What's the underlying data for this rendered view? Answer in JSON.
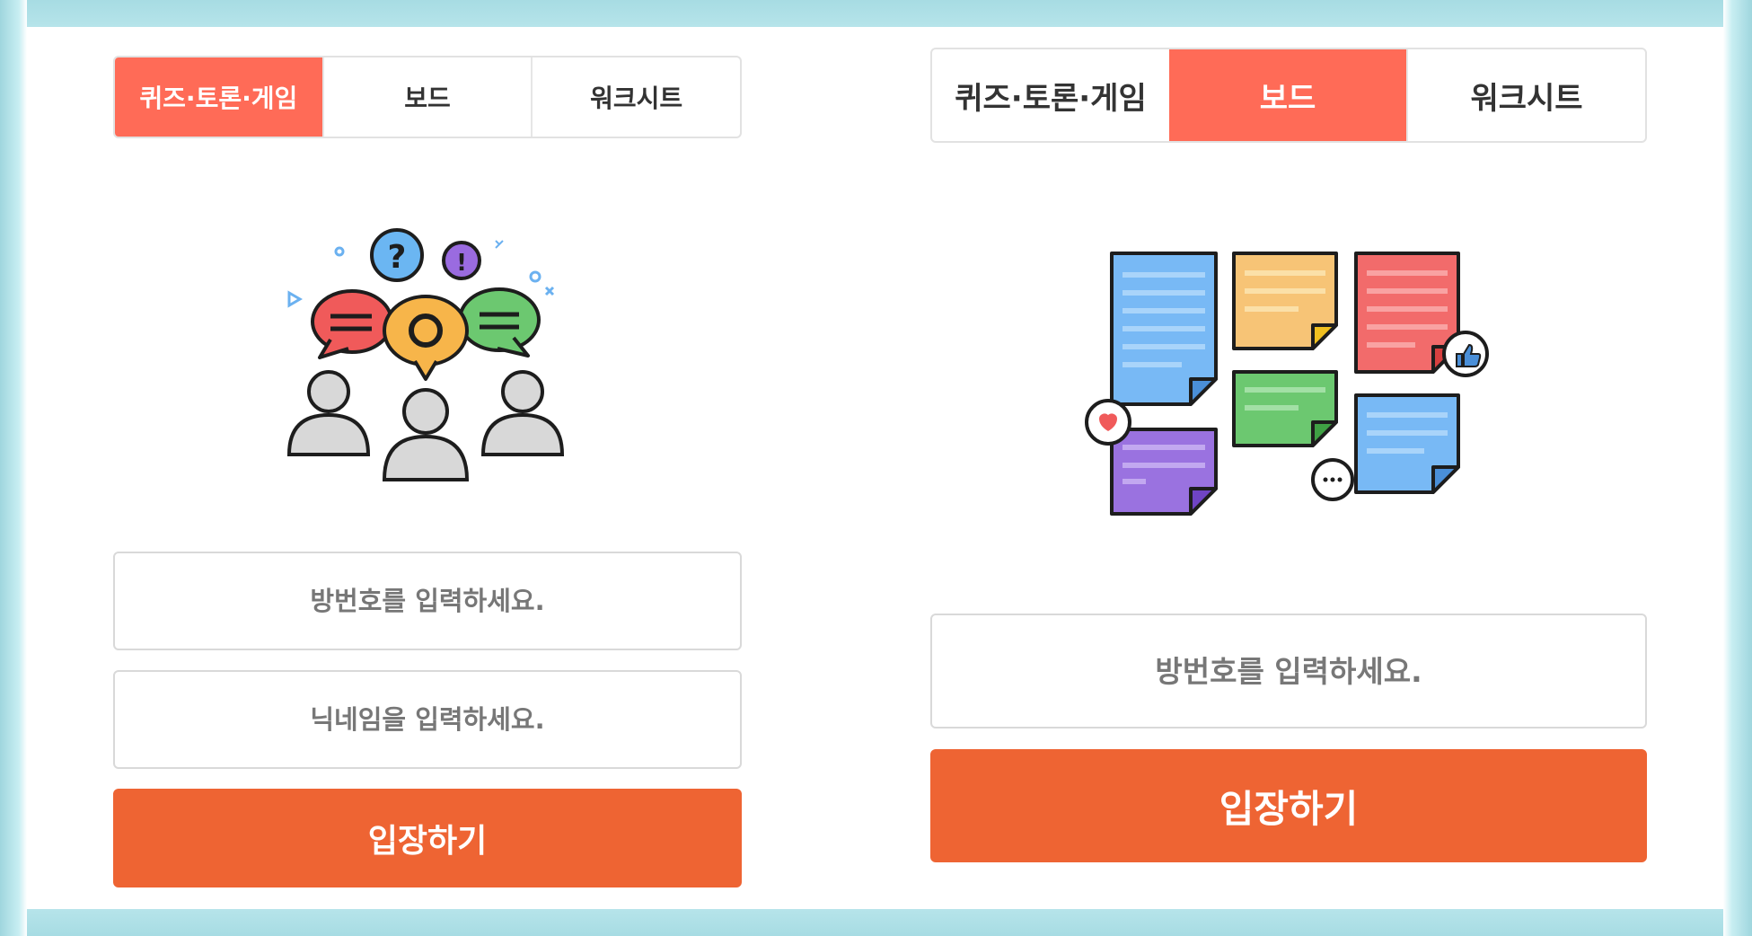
{
  "left_panel": {
    "tabs": [
      {
        "label": "퀴즈·토론·게임",
        "active": true
      },
      {
        "label": "보드",
        "active": false
      },
      {
        "label": "워크시트",
        "active": false
      }
    ],
    "illustration_icon": "discussion-people-icon",
    "room_input": {
      "placeholder": "방번호를 입력하세요.",
      "value": ""
    },
    "nickname_input": {
      "placeholder": "닉네임을 입력하세요.",
      "value": ""
    },
    "enter_button": "입장하기"
  },
  "right_panel": {
    "tabs": [
      {
        "label": "퀴즈·토론·게임",
        "active": false
      },
      {
        "label": "보드",
        "active": true
      },
      {
        "label": "워크시트",
        "active": false
      }
    ],
    "illustration_icon": "sticky-notes-board-icon",
    "room_input": {
      "placeholder": "방번호를 입력하세요.",
      "value": ""
    },
    "enter_button": "입장하기"
  },
  "colors": {
    "active_tab": "#ff6b57",
    "enter_button": "#ee6433",
    "frame": "#b3e2e8"
  }
}
